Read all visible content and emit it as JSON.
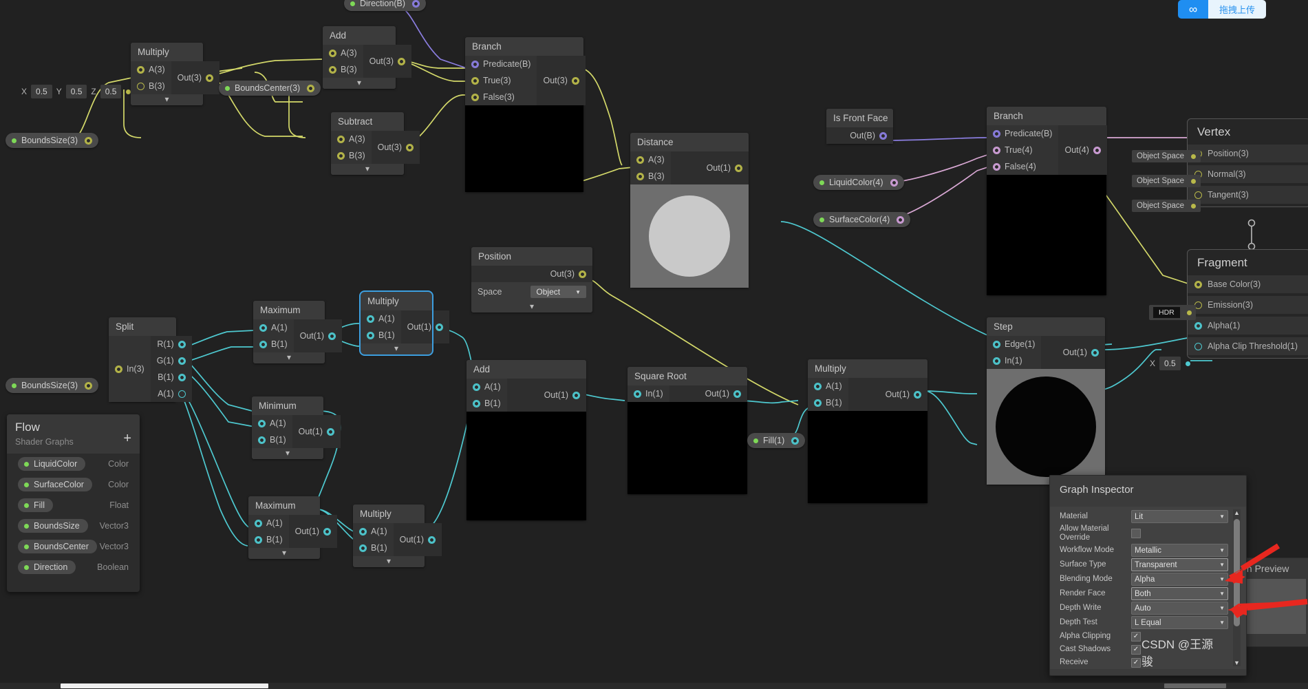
{
  "app": {
    "graph_name": "Flow",
    "watermark": "CSDN @王源骏",
    "upload_button": "拖拽上传"
  },
  "blackboard": {
    "title": "Flow",
    "subtitle": "Shader Graphs",
    "add_label": "+",
    "properties": [
      {
        "name": "LiquidColor",
        "type": "Color"
      },
      {
        "name": "SurfaceColor",
        "type": "Color"
      },
      {
        "name": "Fill",
        "type": "Float"
      },
      {
        "name": "BoundsSize",
        "type": "Vector3"
      },
      {
        "name": "BoundsCenter",
        "type": "Vector3"
      },
      {
        "name": "Direction",
        "type": "Boolean"
      }
    ]
  },
  "nodes": [
    {
      "id": "multiply_top",
      "title": "Multiply",
      "inputs": [
        "A(3)",
        "B(3)"
      ],
      "output": "Out(3)"
    },
    {
      "id": "add_top",
      "title": "Add",
      "inputs": [
        "A(3)",
        "B(3)"
      ],
      "output": "Out(3)"
    },
    {
      "id": "subtract_top",
      "title": "Subtract",
      "inputs": [
        "A(3)",
        "B(3)"
      ],
      "output": "Out(3)"
    },
    {
      "id": "branch_top",
      "title": "Branch",
      "inputs": [
        "Predicate(B)",
        "True(3)",
        "False(3)"
      ],
      "output": "Out(3)"
    },
    {
      "id": "distance",
      "title": "Distance",
      "inputs": [
        "A(3)",
        "B(3)"
      ],
      "output": "Out(1)"
    },
    {
      "id": "position",
      "title": "Position",
      "output": "Out(3)",
      "space_label": "Space",
      "space_value": "Object"
    },
    {
      "id": "is_front_face",
      "title": "Is Front Face",
      "output": "Out(B)"
    },
    {
      "id": "branch_right",
      "title": "Branch",
      "inputs": [
        "Predicate(B)",
        "True(4)",
        "False(4)"
      ],
      "output": "Out(4)"
    },
    {
      "id": "split",
      "title": "Split",
      "inputs": [
        "In(3)"
      ],
      "outputs": [
        "R(1)",
        "G(1)",
        "B(1)",
        "A(1)"
      ]
    },
    {
      "id": "maximum_1",
      "title": "Maximum",
      "inputs": [
        "A(1)",
        "B(1)"
      ],
      "output": "Out(1)"
    },
    {
      "id": "minimum_1",
      "title": "Minimum",
      "inputs": [
        "A(1)",
        "B(1)"
      ],
      "output": "Out(1)"
    },
    {
      "id": "maximum_2",
      "title": "Maximum",
      "inputs": [
        "A(1)",
        "B(1)"
      ],
      "output": "Out(1)"
    },
    {
      "id": "multiply_sel",
      "title": "Multiply",
      "inputs": [
        "A(1)",
        "B(1)"
      ],
      "output": "Out(1)",
      "selected": true
    },
    {
      "id": "multiply_low",
      "title": "Multiply",
      "inputs": [
        "A(1)",
        "B(1)"
      ],
      "output": "Out(1)"
    },
    {
      "id": "add_low",
      "title": "Add",
      "inputs": [
        "A(1)",
        "B(1)"
      ],
      "output": "Out(1)"
    },
    {
      "id": "square_root",
      "title": "Square Root",
      "inputs": [
        "In(1)"
      ],
      "output": "Out(1)"
    },
    {
      "id": "multiply_mid",
      "title": "Multiply",
      "inputs": [
        "A(1)",
        "B(1)"
      ],
      "output": "Out(1)"
    },
    {
      "id": "step",
      "title": "Step",
      "inputs": [
        "Edge(1)",
        "In(1)"
      ],
      "output": "Out(1)"
    }
  ],
  "graph_properties": {
    "bounds_size_a": "BoundsSize(3)",
    "bounds_center": "BoundsCenter(3)",
    "bounds_size_b": "BoundsSize(3)",
    "direction": "Direction(B)",
    "liquid_color": "LiquidColor(4)",
    "surface_color": "SurfaceColor(4)",
    "fill": "Fill(1)"
  },
  "vector_field_top": {
    "labels": [
      "X",
      "Y",
      "Z"
    ],
    "values": [
      "0.5",
      "0.5",
      "0.5"
    ]
  },
  "alpha_clip_field": {
    "label": "X",
    "value": "0.5"
  },
  "master_stack": {
    "vertex": {
      "title": "Vertex",
      "rows": [
        {
          "label": "Position(3)",
          "space": "Object Space"
        },
        {
          "label": "Normal(3)",
          "space": "Object Space"
        },
        {
          "label": "Tangent(3)",
          "space": "Object Space"
        }
      ]
    },
    "fragment": {
      "title": "Fragment",
      "rows": [
        {
          "label": "Base Color(3)",
          "tag": ""
        },
        {
          "label": "Emission(3)",
          "tag": "HDR"
        },
        {
          "label": "Alpha(1)",
          "tag": ""
        },
        {
          "label": "Alpha Clip Threshold(1)",
          "tag": ""
        }
      ]
    }
  },
  "inspector": {
    "title": "Graph Inspector",
    "rows": [
      {
        "label": "Material",
        "type": "dropdown",
        "value": "Lit"
      },
      {
        "label": "Allow Material Override",
        "type": "checkbox",
        "value": ""
      },
      {
        "label": "Workflow Mode",
        "type": "dropdown",
        "value": "Metallic"
      },
      {
        "label": "Surface Type",
        "type": "dropdown",
        "value": "Transparent",
        "highlight": true
      },
      {
        "label": "Blending Mode",
        "type": "dropdown",
        "value": "Alpha"
      },
      {
        "label": "Render Face",
        "type": "dropdown",
        "value": "Both",
        "highlight": true
      },
      {
        "label": "Depth Write",
        "type": "dropdown",
        "value": "Auto"
      },
      {
        "label": "Depth Test",
        "type": "dropdown",
        "value": "L Equal"
      },
      {
        "label": "Alpha Clipping",
        "type": "checkbox",
        "value": "✓"
      },
      {
        "label": "Cast Shadows",
        "type": "checkbox",
        "value": "✓"
      },
      {
        "label": "Receive",
        "type": "checkbox",
        "value": "✓"
      }
    ]
  },
  "main_preview": {
    "title": "ain Preview"
  },
  "colors": {
    "vector_wire": "#d4d96a",
    "float_wire": "#4ec9d0",
    "bool_wire": "#8b7ee0",
    "color_wire": "#d9a8d4",
    "selection": "#3d9fe0",
    "property_dot": "#7ed957",
    "accent_blue": "#1f8ef1",
    "arrow_red": "#e8271f",
    "canvas_bg": "#212121"
  }
}
